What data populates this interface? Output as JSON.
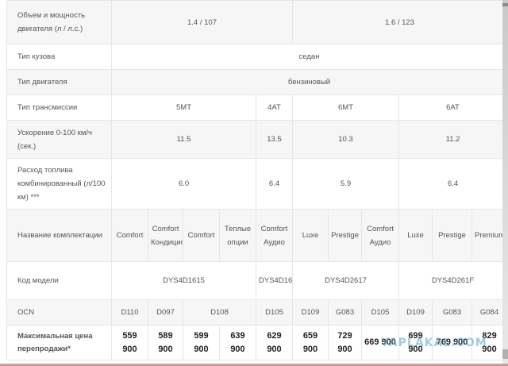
{
  "table": {
    "engine": {
      "label": "Объем и мощность двигателя (л / л.с.)",
      "values": [
        "1.4 / 107",
        "1.6 / 123"
      ]
    },
    "body_type": {
      "label": "Тип кузова",
      "value": "седан"
    },
    "engine_type": {
      "label": "Тип двигателя",
      "value": "бензиновый"
    },
    "transmission": {
      "label": "Тип трансмиссии",
      "values": [
        "5MT",
        "4AT",
        "6MT",
        "6AT"
      ]
    },
    "acceleration": {
      "label": "Ускорение 0-100 км/ч (сек.)",
      "values": [
        "11.5",
        "13.5",
        "10.3",
        "11.2"
      ]
    },
    "fuel": {
      "label": "Расход топлива комбинированный (л/100 км) ***",
      "values": [
        "6.0",
        "6.4",
        "5.9",
        "6.4"
      ]
    },
    "trims": {
      "label": "Название комплектации",
      "values": [
        "Comfort",
        "Comfort Кондиционер",
        "Comfort",
        "Теплые опции",
        "Comfort Аудио",
        "Luxe",
        "Prestige",
        "Comfort Аудио",
        "Luxe",
        "Prestige",
        "Premium"
      ]
    },
    "model_code": {
      "label": "Код модели",
      "values": [
        "DYS4D1615",
        "DYS4D161B",
        "DYS4D2617",
        "DYS4D261F"
      ]
    },
    "ocn": {
      "label": "OCN",
      "values": [
        "D110",
        "D097",
        "D108",
        "D105",
        "D109",
        "G083",
        "D105",
        "D109",
        "G083",
        "G084"
      ]
    },
    "price": {
      "label": "Максимальная цена перепродажи*",
      "values": [
        "559 900",
        "589 900",
        "599 900",
        "639 900",
        "629 900",
        "659 900",
        "729 900",
        "669 900",
        "699 900",
        "769 900",
        "829 900"
      ]
    }
  },
  "watermark": "YAPLAKAL.COM"
}
